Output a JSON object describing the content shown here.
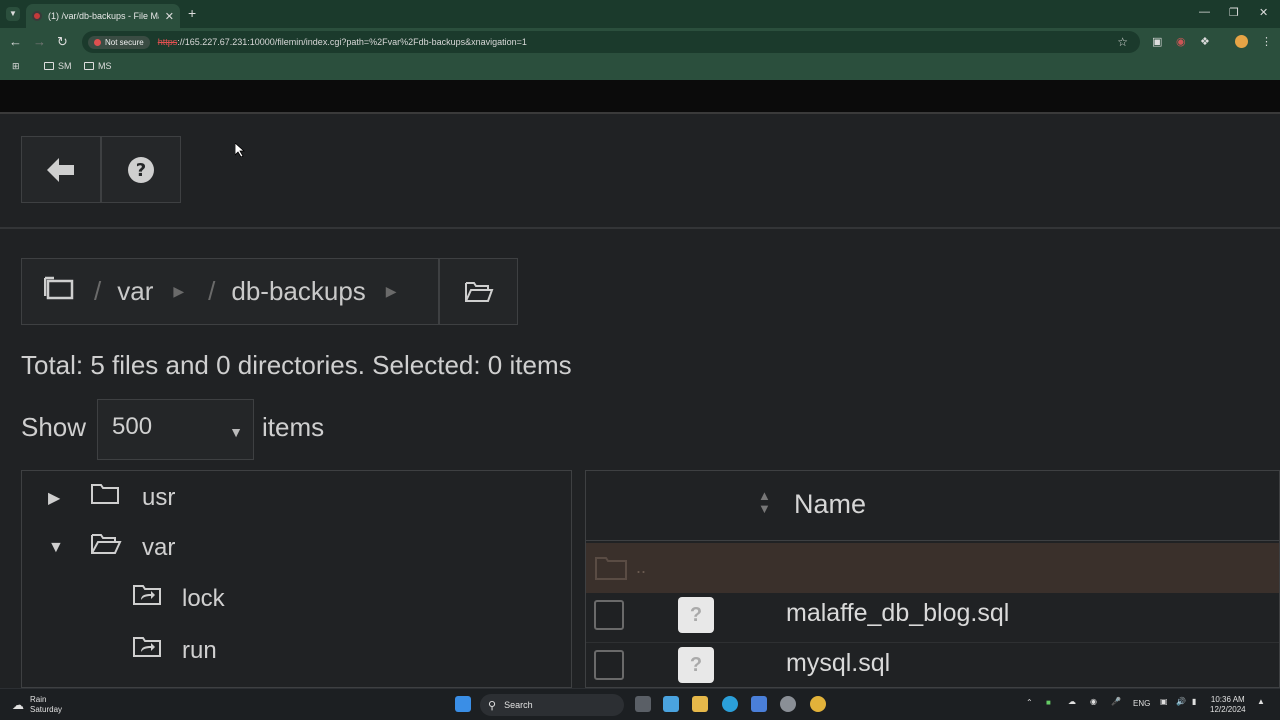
{
  "browser": {
    "tab_title": "(1) /var/db-backups - File Mana",
    "new_tab": "+",
    "security_label": "Not secure",
    "url_proto": "https",
    "url_rest": "://165.227.67.231:10000/filemin/index.cgi?path=%2Fvar%2Fdb-backups&xnavigation=1",
    "bookmarks": [
      "SM",
      "MS"
    ],
    "profile_color": "#e6a446"
  },
  "breadcrumb": {
    "root_sep": "/",
    "items": [
      "var",
      "db-backups"
    ]
  },
  "status": {
    "total": "Total: 5 files and 0 directories. Selected: 0 items"
  },
  "pagination": {
    "show_label": "Show",
    "selected": "500",
    "items_label": "items"
  },
  "tree": {
    "nodes": [
      {
        "label": "usr",
        "expanded": false
      },
      {
        "label": "var",
        "expanded": true
      },
      {
        "label": "lock"
      },
      {
        "label": "run"
      }
    ]
  },
  "files": {
    "column_name": "Name",
    "updir": "..",
    "rows": [
      {
        "name": "malaffe_db_blog.sql"
      },
      {
        "name": "mysql.sql"
      }
    ]
  },
  "taskbar": {
    "weather_label": "Rain",
    "weather_day": "Saturday",
    "search": "Search",
    "lang": "ENG",
    "time": "10:36 AM",
    "date": "12/2/2024"
  },
  "colors": {
    "accent_green": "#2b4f3d",
    "page_bg": "#202224",
    "updir_row": "#3a302b"
  }
}
